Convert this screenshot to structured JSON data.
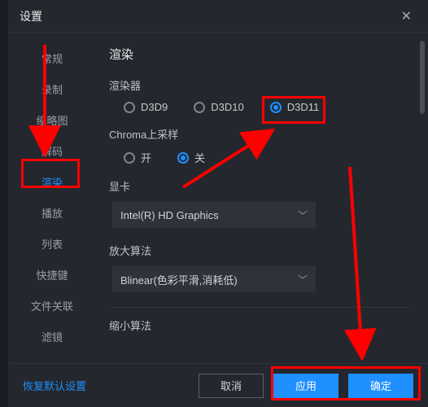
{
  "title": "设置",
  "sidebar": {
    "items": [
      {
        "label": "常规"
      },
      {
        "label": "录制"
      },
      {
        "label": "缩略图"
      },
      {
        "label": "解码"
      },
      {
        "label": "渲染"
      },
      {
        "label": "播放"
      },
      {
        "label": "列表"
      },
      {
        "label": "快捷键"
      },
      {
        "label": "文件关联"
      },
      {
        "label": "滤镜"
      }
    ],
    "active_index": 4
  },
  "content": {
    "heading": "渲染",
    "renderer": {
      "label": "渲染器",
      "options": [
        "D3D9",
        "D3D10",
        "D3D11"
      ],
      "selected_index": 2
    },
    "chroma": {
      "label": "Chroma上采样",
      "options": [
        "开",
        "关"
      ],
      "selected_index": 1
    },
    "gpu": {
      "label": "显卡",
      "value": "Intel(R) HD Graphics"
    },
    "upscale": {
      "label": "放大算法",
      "value": "Blinear(色彩平滑,消耗低)"
    },
    "downscale": {
      "label": "缩小算法"
    }
  },
  "footer": {
    "reset": "恢复默认设置",
    "cancel": "取消",
    "apply": "应用",
    "ok": "确定"
  },
  "colors": {
    "accent": "#1e90ff",
    "annotation": "#ff0000",
    "bg": "#24272e"
  }
}
